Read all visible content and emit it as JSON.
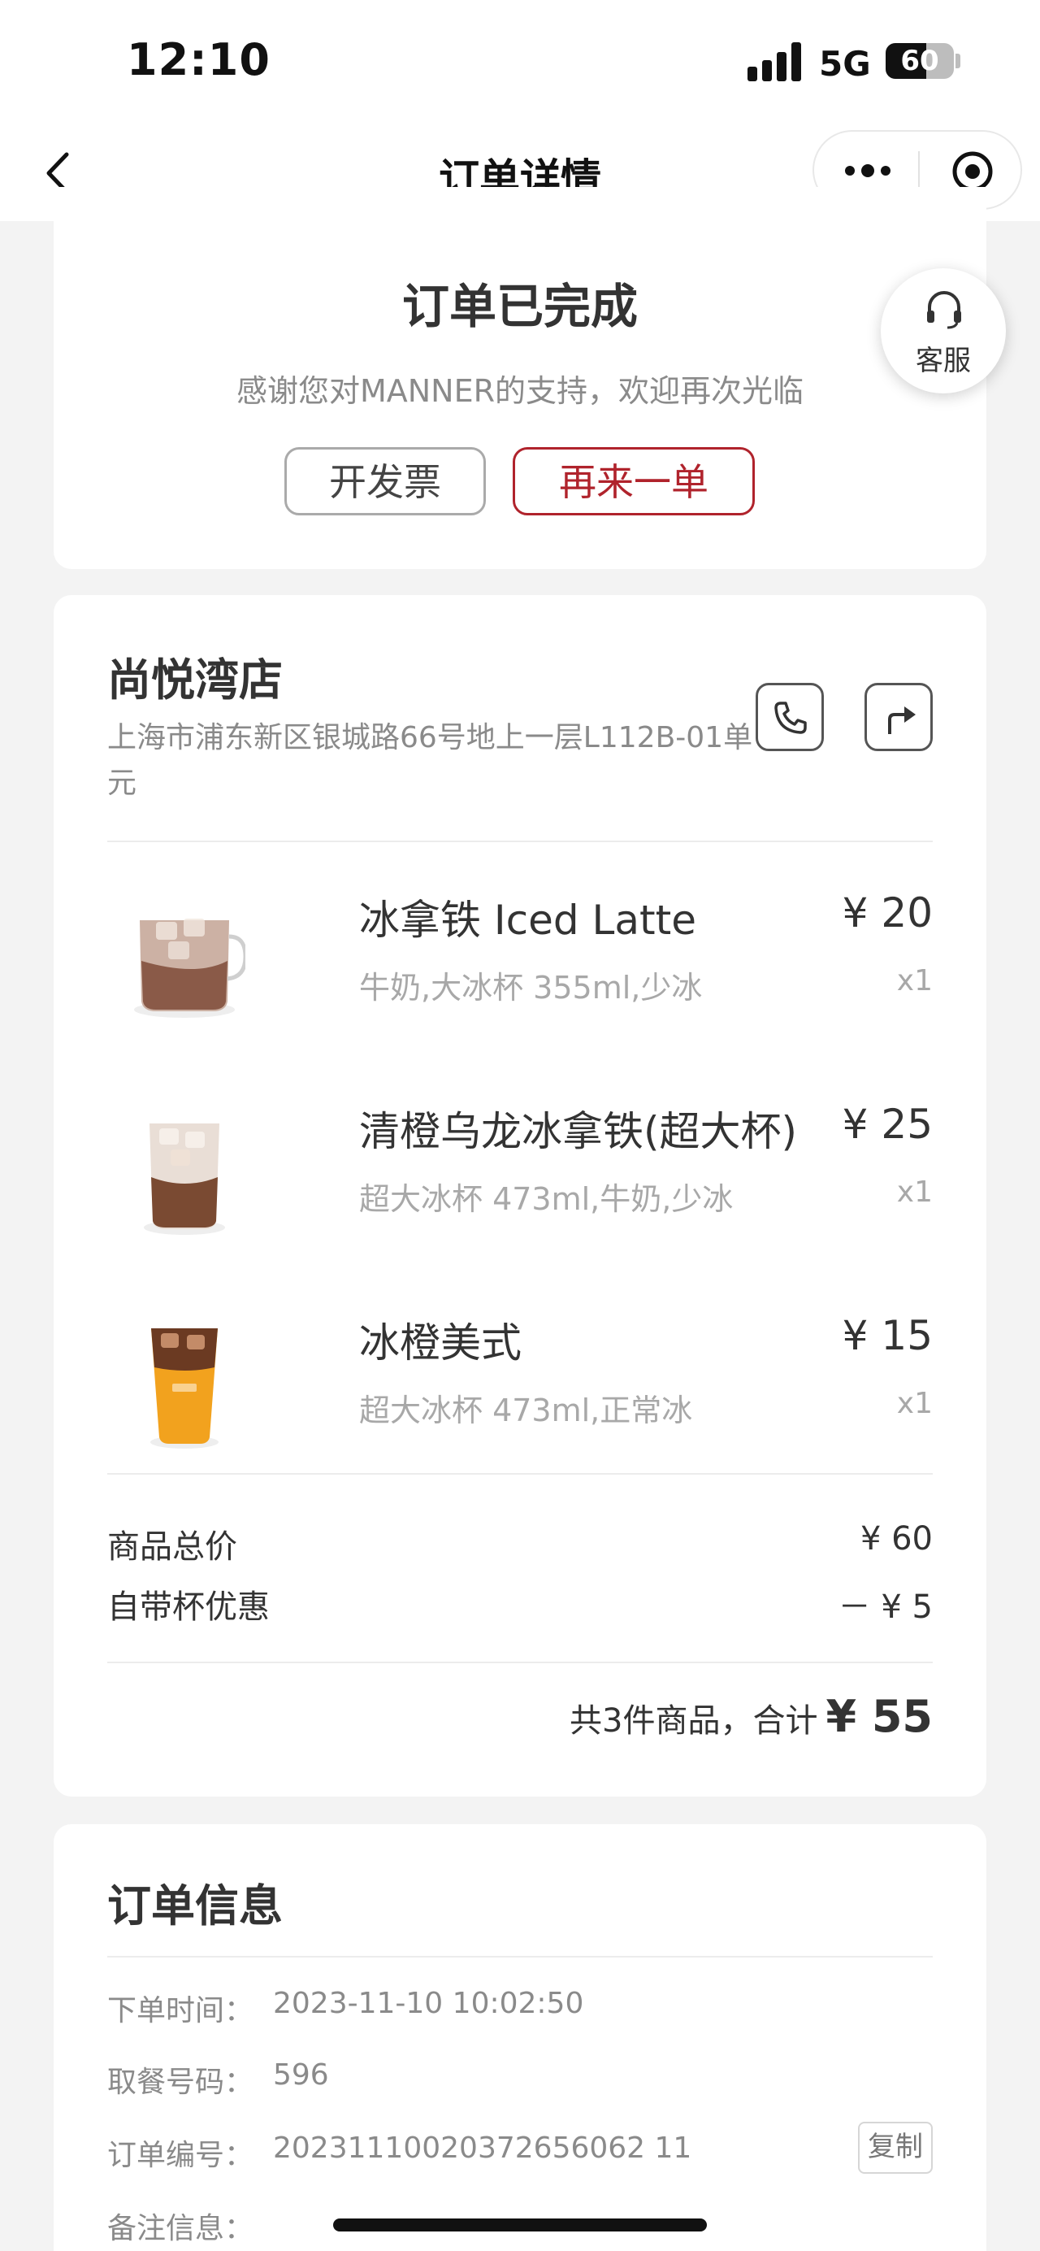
{
  "status_bar": {
    "time": "12:10",
    "network": "5G",
    "battery": "60",
    "battery_level": 0.6
  },
  "nav": {
    "title": "订单详情",
    "back_icon": "chevron-left-icon",
    "more_icon": "more-dots-icon",
    "close_icon": "target-circle-icon"
  },
  "status": {
    "title": "订单已完成",
    "subtitle": "感谢您对MANNER的支持，欢迎再次光临",
    "invoice_button": "开发票",
    "reorder_button": "再来一单",
    "accent_color": "#b0232c"
  },
  "service": {
    "label": "客服",
    "icon": "headset-icon"
  },
  "store": {
    "name": "尚悦湾店",
    "address": "上海市浦东新区银城路66号地上一层L112B-01单元",
    "phone_icon": "phone-icon",
    "navigate_icon": "navigation-arrow-icon"
  },
  "items": [
    {
      "name": "冰拿铁 Iced Latte",
      "spec": "牛奶,大冰杯 355ml,少冰",
      "price": "¥ 20",
      "qty": "x1"
    },
    {
      "name": "清橙乌龙冰拿铁(超大杯)",
      "spec": "超大冰杯 473ml,牛奶,少冰",
      "price": "¥ 25",
      "qty": "x1"
    },
    {
      "name": "冰橙美式",
      "spec": "超大冰杯 473ml,正常冰",
      "price": "¥ 15",
      "qty": "x1"
    }
  ],
  "summary": {
    "goods_total_label": "商品总价",
    "goods_total_value": "¥ 60",
    "cup_discount_label": "自带杯优惠",
    "cup_discount_value": "－ ¥ 5",
    "count_text": "共3件商品，合计",
    "total": "¥ 55"
  },
  "order_info": {
    "title": "订单信息",
    "rows": [
      {
        "label": "下单时间：",
        "value": "2023-11-10 10:02:50"
      },
      {
        "label": "取餐号码：",
        "value": "596"
      },
      {
        "label": "订单编号：",
        "value": "20231110020372656062 11"
      },
      {
        "label": "备注信息：",
        "value": ""
      }
    ],
    "copy_button": "复制"
  }
}
